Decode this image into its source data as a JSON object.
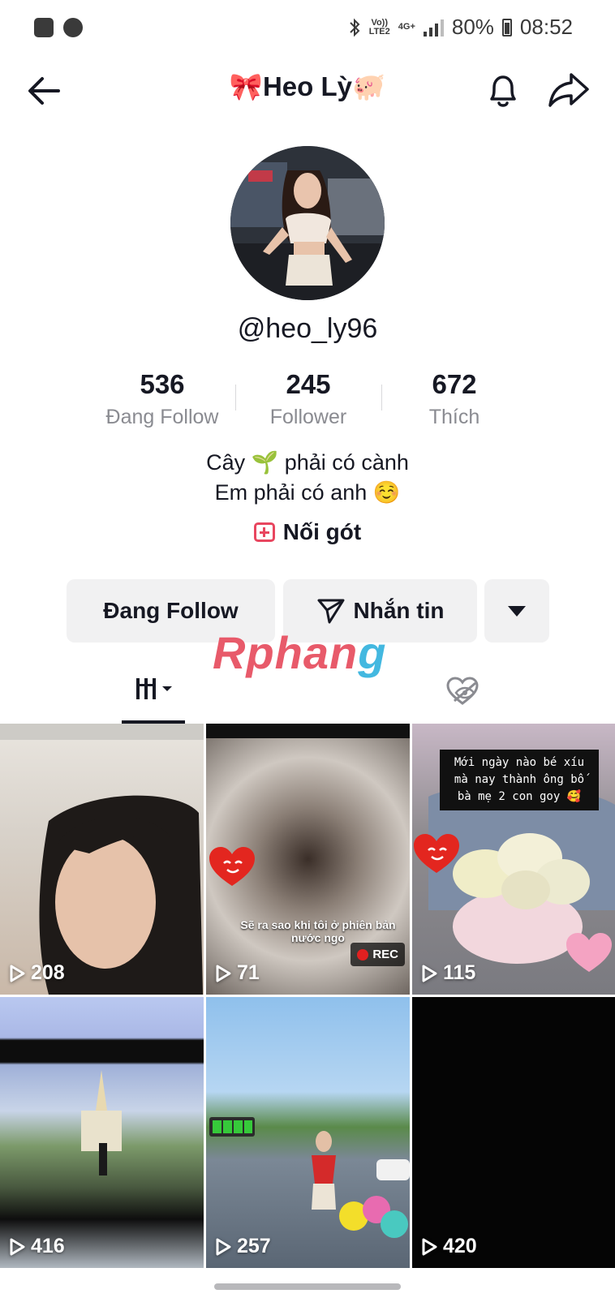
{
  "status_bar": {
    "network_top": "Vo))",
    "network_bottom": "LTE2",
    "data_type": "4G+",
    "battery": "80%",
    "time": "08:52"
  },
  "nav": {
    "title": "🎀Heo  Lỳ🐖"
  },
  "profile": {
    "handle": "@heo_ly96",
    "stats": [
      {
        "value": "536",
        "label": "Đang Follow"
      },
      {
        "value": "245",
        "label": "Follower"
      },
      {
        "value": "672",
        "label": "Thích"
      }
    ],
    "bio_line1": "Cây 🌱 phải có cành",
    "bio_line2": "Em phải có anh ☺️",
    "link_label": "Nối gót"
  },
  "actions": {
    "following_label": "Đang Follow",
    "message_label": "Nhắn tin"
  },
  "watermark": {
    "part1": "Rphan",
    "part2": "g"
  },
  "videos": [
    {
      "views": "208",
      "overlay": ""
    },
    {
      "views": "71",
      "overlay": "Sẽ ra sao khi tôi ở phiên bản nước ngo",
      "badge": "REC"
    },
    {
      "views": "115",
      "overlay": "Mới ngày nào bé xíu mà nay thành ông bố bà mẹ 2 con goy 🥰"
    },
    {
      "views": "416",
      "overlay": ""
    },
    {
      "views": "257",
      "overlay": ""
    },
    {
      "views": "420",
      "overlay": ""
    }
  ],
  "colors": {
    "accent_pink": "#e8465f",
    "button_bg": "#f1f1f2",
    "text_primary": "#161823",
    "text_secondary": "#8a8b91"
  }
}
